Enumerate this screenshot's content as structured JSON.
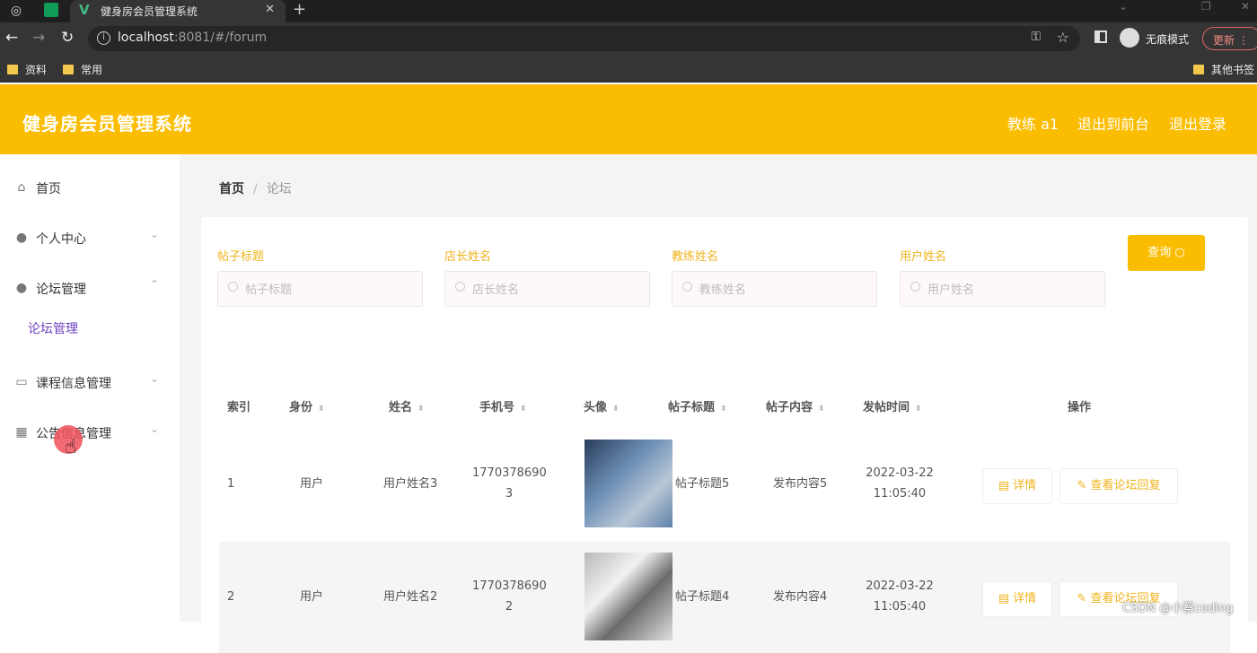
{
  "browser": {
    "tab_title": "健身房会员管理系统",
    "url_host": "localhost",
    "url_rest": ":8081/#/forum",
    "incognito_label": "无痕模式",
    "update_label": "更新",
    "bookmarks": [
      "资料",
      "常用"
    ],
    "other_bookmarks": "其他书签"
  },
  "header": {
    "title": "健身房会员管理系统",
    "user": "教练 a1",
    "front_link": "退出到前台",
    "logout_link": "退出登录"
  },
  "sidebar": {
    "items": [
      {
        "label": "首页",
        "icon": "home-icon"
      },
      {
        "label": "个人中心",
        "icon": "user-icon"
      },
      {
        "label": "论坛管理",
        "icon": "user-icon"
      },
      {
        "label": "课程信息管理",
        "icon": "card-icon"
      },
      {
        "label": "公告信息管理",
        "icon": "grid-icon"
      }
    ],
    "sub_item": "论坛管理"
  },
  "breadcrumb": {
    "home": "首页",
    "current": "论坛"
  },
  "search": {
    "fields": [
      {
        "label": "帖子标题",
        "placeholder": "帖子标题"
      },
      {
        "label": "店长姓名",
        "placeholder": "店长姓名"
      },
      {
        "label": "教练姓名",
        "placeholder": "教练姓名"
      },
      {
        "label": "用户姓名",
        "placeholder": "用户姓名"
      }
    ],
    "query_label": "查询"
  },
  "table": {
    "headers": [
      "索引",
      "身份",
      "姓名",
      "手机号",
      "头像",
      "帖子标题",
      "帖子内容",
      "发帖时间",
      "操作"
    ],
    "rows": [
      {
        "index": "1",
        "identity": "用户",
        "name": "用户姓名3",
        "phone_a": "1770378690",
        "phone_b": "3",
        "title": "帖子标题5",
        "content": "发布内容5",
        "date": "2022-03-22",
        "time": "11:05:40"
      },
      {
        "index": "2",
        "identity": "用户",
        "name": "用户姓名2",
        "phone_a": "1770378690",
        "phone_b": "2",
        "title": "帖子标题4",
        "content": "发布内容4",
        "date": "2022-03-22",
        "time": "11:05:40"
      }
    ],
    "detail_label": "详情",
    "reply_label": "查看论坛回复"
  },
  "watermark": "CSDN @小蔡coding",
  "colors": {
    "accent": "#fbbd01",
    "label": "#f0b41e",
    "active_sub": "#6c3fbf"
  }
}
